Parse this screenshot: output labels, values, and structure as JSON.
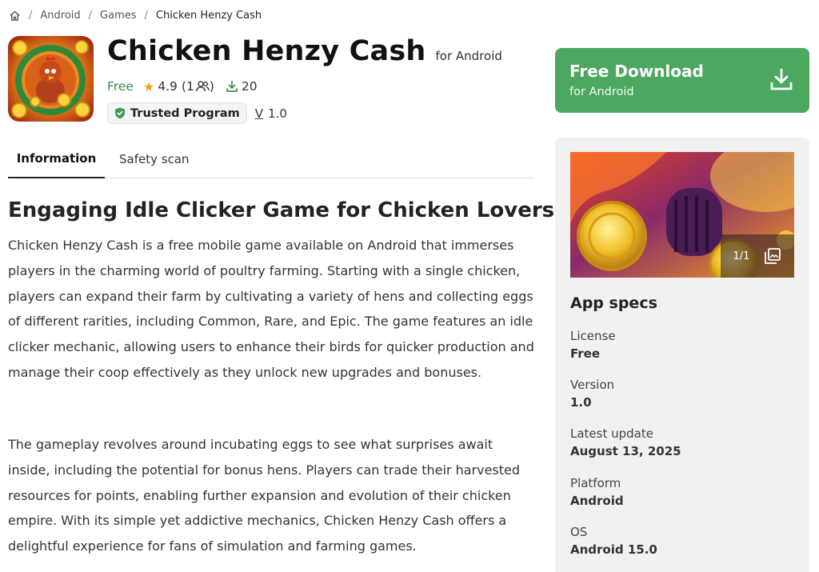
{
  "breadcrumb": {
    "home_icon": "home-icon",
    "separator": "/",
    "items": [
      "Android",
      "Games",
      "Chicken Henzy Cash"
    ]
  },
  "app": {
    "title": "Chicken Henzy Cash",
    "platform_suffix": "for Android",
    "price": "Free",
    "rating": "4.9",
    "rating_count_open": "(1",
    "rating_count_close": ")",
    "downloads": "20",
    "trusted_label": "Trusted Program",
    "version_prefix": "V",
    "version": "1.0"
  },
  "tabs": [
    {
      "label": "Information",
      "active": true
    },
    {
      "label": "Safety scan",
      "active": false
    }
  ],
  "article": {
    "heading": "Engaging Idle Clicker Game for Chicken Lovers",
    "paragraphs": [
      "Chicken Henzy Cash is a free mobile game available on Android that immerses players in the charming world of poultry farming. Starting with a single chicken, players can expand their farm by cultivating a variety of hens and collecting eggs of different rarities, including Common, Rare, and Epic. The game features an idle clicker mechanic, allowing users to enhance their birds for quicker production and manage their coop effectively as they unlock new upgrades and bonuses.",
      "The gameplay revolves around incubating eggs to see what surprises await inside, including the potential for bonus hens. Players can trade their harvested resources for points, enabling further expansion and evolution of their chicken empire. With its simple yet addictive mechanics, Chicken Henzy Cash offers a delightful experience for fans of simulation and farming games."
    ]
  },
  "download": {
    "title": "Free Download",
    "subtitle": "for Android",
    "icon": "download-icon"
  },
  "gallery": {
    "counter": "1/1",
    "icon": "gallery-icon"
  },
  "specs": {
    "title": "App specs",
    "items": [
      {
        "label": "License",
        "value": "Free"
      },
      {
        "label": "Version",
        "value": "1.0"
      },
      {
        "label": "Latest update",
        "value": "August 13, 2025"
      },
      {
        "label": "Platform",
        "value": "Android"
      },
      {
        "label": "OS",
        "value": "Android 15.0"
      }
    ]
  },
  "colors": {
    "accent_green": "#4ca760",
    "price_green": "#3a8a4c",
    "star": "#f0a020",
    "panel_bg": "#f1f1f1"
  }
}
